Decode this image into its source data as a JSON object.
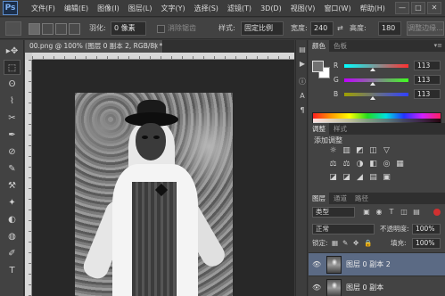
{
  "app": {
    "logo": "Ps"
  },
  "menu": [
    "文件(F)",
    "编辑(E)",
    "图像(I)",
    "图层(L)",
    "文字(Y)",
    "选择(S)",
    "滤镜(T)",
    "3D(D)",
    "视图(V)",
    "窗口(W)",
    "帮助(H)"
  ],
  "window_controls": {
    "minimize": "—",
    "restore": "□",
    "close": "✕"
  },
  "options": {
    "feather_label": "羽化:",
    "feather_value": "0 像素",
    "antialias_label": "消除锯齿",
    "style_label": "样式:",
    "style_value": "固定比例",
    "width_label": "宽度:",
    "width_value": "240",
    "height_label": "高度:",
    "height_value": "180",
    "refine_edge": "调整边缘..."
  },
  "document": {
    "tab_title": "00.png @ 100% (图层 0 副本 2, RGB/8) *",
    "close": "×"
  },
  "color_panel": {
    "tabs": [
      "颜色",
      "色板"
    ],
    "menu": "▾≡",
    "channels": [
      {
        "label": "R",
        "value": "113",
        "track_from": "#00ffff",
        "track_to": "#ff3030",
        "level": 0.443
      },
      {
        "label": "G",
        "value": "113",
        "track_from": "#c000ff",
        "track_to": "#40ff20",
        "level": 0.443
      },
      {
        "label": "B",
        "value": "113",
        "track_from": "#a0a000",
        "track_to": "#3040ff",
        "level": 0.443
      }
    ],
    "foreground": "#717171",
    "background": "#ffffff"
  },
  "adjustments_panel": {
    "tabs": [
      "调整",
      "样式"
    ],
    "title": "添加调整",
    "row1": [
      "☼",
      "▥",
      "◩",
      "◫",
      "▽"
    ],
    "row2": [
      "⚖",
      "⚖",
      "◑",
      "◧",
      "◎",
      "▦"
    ],
    "row3": [
      "◪",
      "◪",
      "◢",
      "▤",
      "▣"
    ]
  },
  "layers_panel": {
    "tabs": [
      "图层",
      "通道",
      "路径"
    ],
    "kind_label": "类型",
    "filter_icons": [
      "▣",
      "◉",
      "T",
      "◫",
      "▤"
    ],
    "blend_mode": "正常",
    "opacity_label": "不透明度:",
    "opacity_value": "100%",
    "lock_label": "锁定:",
    "lock_icons": [
      "▦",
      "✎",
      "✥",
      "🔒"
    ],
    "fill_label": "填充:",
    "fill_value": "100%",
    "layers": [
      {
        "name": "图层 0 副本 2",
        "selected": true
      },
      {
        "name": "图层 0 副本",
        "selected": false
      }
    ]
  },
  "toolbar_icons": [
    "▸✥",
    "⬚",
    "ʘ",
    "⌇",
    "✂",
    "✒",
    "⊘",
    "✎",
    "⚒",
    "✦",
    "◐",
    "◍",
    "✐",
    "T"
  ]
}
